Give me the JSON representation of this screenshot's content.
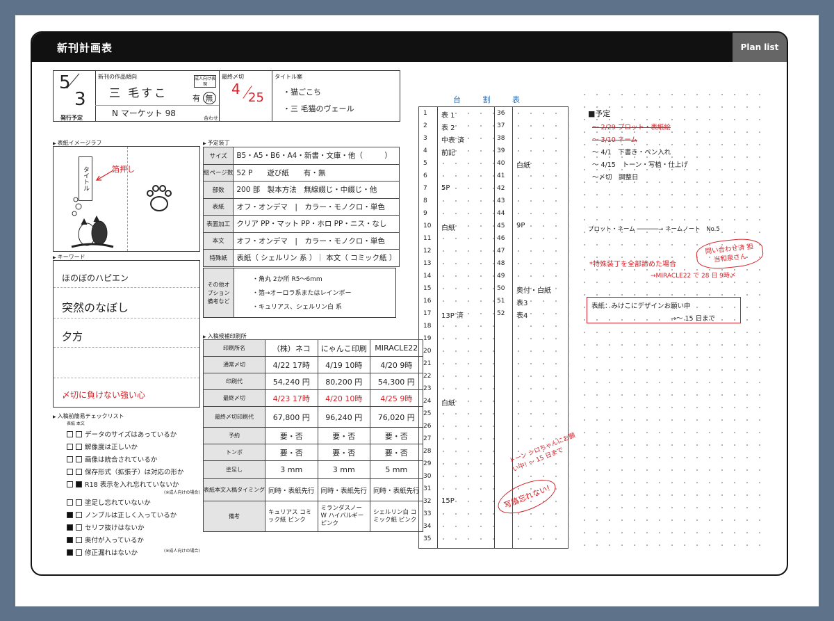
{
  "header": {
    "title": "新刊計画表",
    "tab": "Plan list"
  },
  "info": {
    "date_month": "5",
    "date_day": "3",
    "date_label": "発行予定",
    "genre_label": "新刊の作品傾向",
    "author": "三 毛すこ",
    "adult_label": "成人向け表現",
    "adult_yes": "有",
    "adult_no": "無",
    "event": "N マーケット 98",
    "event_label": "合わせ",
    "deadline_label": "最終〆切",
    "deadline_m": "4",
    "deadline_d": "25",
    "titles_label": "タイトル案",
    "title_1": "・猫ごこち",
    "title_2": "・三 毛猫のヴェール"
  },
  "cover": {
    "section": "表紙イメージラフ",
    "title_text": "タイトル",
    "note": "箔押し"
  },
  "keywords": {
    "section": "キーワード",
    "items": [
      "ほのぼのハピエン",
      "突然のなぼし",
      "夕方"
    ],
    "red": "〆切に負けない強い心"
  },
  "spec": {
    "section": "予定装丁",
    "rows": [
      {
        "k": "サイズ",
        "v": "B5・A5・B6・A4・新書・文庫・他（　　　）"
      },
      {
        "k": "総ページ数",
        "v": "52 P　　遊び紙　　有・無"
      },
      {
        "k": "部数",
        "v": "200 部　製本方法　無線綴じ・中綴じ・他"
      },
      {
        "k": "表紙",
        "v": "オフ・オンデマ　|　カラー・モノクロ・単色"
      },
      {
        "k": "表面加工",
        "v": "クリア PP・マット PP・ホロ PP・ニス・なし"
      },
      {
        "k": "本文",
        "v": "オフ・オンデマ　|　カラー・モノクロ・単色"
      },
      {
        "k": "特殊紙",
        "v": "表紙（ シェルリン 系 ）｜ 本文（ コミック紙 ）"
      }
    ],
    "option_label": "その他オプション備考など",
    "options": [
      "・角丸 2か所 R5～6mm",
      "・箔→オーロラ系またはレインボー",
      "・キュリアス、シェルリン白 系"
    ]
  },
  "printers": {
    "section": "入稿候補印刷所",
    "rows": [
      {
        "k": "印刷所名",
        "c": [
          "（株）ネコ",
          "にゃんこ印刷",
          "MIRACLE22"
        ]
      },
      {
        "k": "通常〆切",
        "c": [
          "4/22 17時",
          "4/19 10時",
          "4/20 9時"
        ]
      },
      {
        "k": "印刷代",
        "c": [
          "54,240 円",
          "80,200 円",
          "54,300 円"
        ]
      },
      {
        "k": "最終〆切",
        "c": [
          "4/23 17時",
          "4/20 10時",
          "4/25 9時"
        ]
      },
      {
        "k": "最終〆切印刷代",
        "c": [
          "67,800 円",
          "96,240 円",
          "76,020 円"
        ]
      },
      {
        "k": "予約",
        "c": [
          "要・否",
          "要・否",
          "要・否"
        ]
      },
      {
        "k": "トンボ",
        "c": [
          "要・否",
          "要・否",
          "要・否"
        ]
      },
      {
        "k": "塗足し",
        "c": [
          "3 mm",
          "3 mm",
          "5 mm"
        ]
      },
      {
        "k": "表紙本文入稿タイミング",
        "c": [
          "同時・表紙先行",
          "同時・表紙先行",
          "同時・表紙先行"
        ]
      },
      {
        "k": "備考",
        "c": [
          "キュリアス コミック紙 ピンク",
          "ミランダスノーW ハイバルギー ピンク",
          "シェルリン白 コミック紙 ピンク"
        ]
      }
    ]
  },
  "checklist": {
    "section": "入稿前簡易チェックリスト",
    "head": "表紙 本文",
    "items": [
      {
        "t": "データのサイズはあっているか",
        "a": 0,
        "b": 0
      },
      {
        "t": "解像度は正しいか",
        "a": 0,
        "b": 0
      },
      {
        "t": "画像は統合されているか",
        "a": 0,
        "b": 0
      },
      {
        "t": "保存形式（拡張子）は対応の形か",
        "a": 0,
        "b": 0
      },
      {
        "t": "R18 表示を入れ忘れていないか",
        "a": 0,
        "b": 1
      },
      {
        "t": "塗足し忘れていないか",
        "a": 0,
        "b": 0
      },
      {
        "t": "ノンブルは正しく入っているか",
        "a": 1,
        "b": 0
      },
      {
        "t": "セリフ抜けはないか",
        "a": 1,
        "b": 0
      },
      {
        "t": "奥付が入っているか",
        "a": 1,
        "b": 0
      },
      {
        "t": "修正漏れはないか",
        "a": 1,
        "b": 0
      }
    ],
    "note1": "(※成人向けの場合)",
    "note2": "(※成人向けの場合)"
  },
  "pageplan": {
    "title": "台 割 表",
    "left_notes": [
      {
        "p": 1,
        "t": "表 1"
      },
      {
        "p": 2,
        "t": "表 2"
      },
      {
        "p": 3,
        "t": "中表 済"
      },
      {
        "p": 4,
        "t": "前記"
      },
      {
        "p": 7,
        "t": "5P"
      },
      {
        "p": 10,
        "t": "白紙"
      },
      {
        "p": 17,
        "t": "13P 済"
      },
      {
        "p": 24,
        "t": "白紙"
      },
      {
        "p": 32,
        "t": "15P"
      }
    ],
    "right_notes": [
      {
        "p": 40,
        "t": "白紙"
      },
      {
        "p": 45,
        "t": "9P"
      },
      {
        "p": 50,
        "t": "奥付・白紙"
      },
      {
        "p": 51,
        "t": "表3"
      },
      {
        "p": 52,
        "t": "表4"
      }
    ],
    "memo": "トーン シロちゃんにお願い中! ～ 15 日まで",
    "memo2": "写植忘れない!"
  },
  "schedule": {
    "title": "予定",
    "items": [
      "～ 2/29 プロット・表紙絵",
      "～ 3/10 ネーム",
      "～ 4/1　下書き・ペン入れ",
      "～ 4/15　トーン・写植・仕上げ",
      "～〆切　調整日"
    ],
    "flow": "プロット・ネーム ──────→ ネームノート　No.5",
    "bubble": "問い合わせ済 担当和泉さん",
    "special": "*特殊装丁を全部諦めた場合",
    "special2": "→MIRACLE22 で 28 日 9時〆",
    "box": "表紙：みけこにデザインお願い中",
    "box2": "→～ 15 日まで"
  }
}
